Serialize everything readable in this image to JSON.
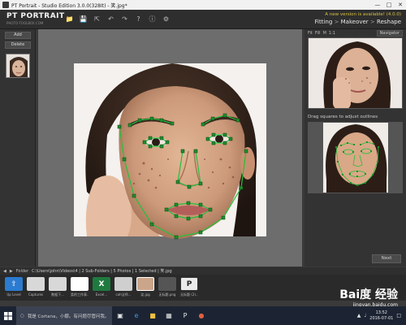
{
  "window": {
    "title": "PT Portrait - Studio Edition 3.0.0(328It) - 笑.jpg*",
    "minimize_icon": "minimize-icon",
    "maximize_icon": "maximize-icon",
    "close_icon": "close-icon"
  },
  "header": {
    "logo_name": "PT PORTRAIT",
    "logo_site": "PHOTO-TOOLBOX.COM",
    "update_notice": "A new version is available! (4.0.0)",
    "steps": [
      "Fitting",
      "Makeover",
      "Reshape"
    ],
    "toolbar_icons": [
      "open-folder-icon",
      "save-icon",
      "share-icon",
      "undo-icon",
      "redo-icon",
      "help-icon",
      "info-icon",
      "settings-icon"
    ]
  },
  "left_panel": {
    "add_label": "Add",
    "delete_label": "Delete"
  },
  "navigator": {
    "fit_label": "Fit",
    "fill_label": "Fill",
    "mode_label": "M",
    "zoom_label": "1:1",
    "select_label": "Navigator"
  },
  "outline": {
    "hint": "Drag squares to adjust outlines"
  },
  "next_label": "Next",
  "folder_bar": {
    "label": "Folder",
    "path": "C:\\Users\\john\\Videos\\4 | 2 Sub-Folders | 5 Photos | 1 Selected | 笑.jpg"
  },
  "strip": [
    {
      "label": "Up Level",
      "color": "#2b7bd1"
    },
    {
      "label": "Captures",
      "color": "#d8d8d8"
    },
    {
      "label": "数据下...",
      "color": "#d8d8d8"
    },
    {
      "label": "类的工作表...",
      "color": "#ffffff"
    },
    {
      "label": "Excel...",
      "color": "#1f7a3f"
    },
    {
      "label": "coh法师...",
      "color": "#cfcfcf"
    },
    {
      "label": "笑.jpg",
      "color": "#caa58a"
    },
    {
      "label": "无标题.png",
      "color": "#555"
    },
    {
      "label": "无标题 (2)...",
      "color": "#eaeaea"
    }
  ],
  "taskbar": {
    "search_text": "我是 Cortana，小娜。有问题尽管问我。",
    "time": "13:52",
    "date": "2016-07-01"
  },
  "watermark": {
    "brand": "Bai度 经验",
    "site": "jingyan.baidu.com"
  }
}
